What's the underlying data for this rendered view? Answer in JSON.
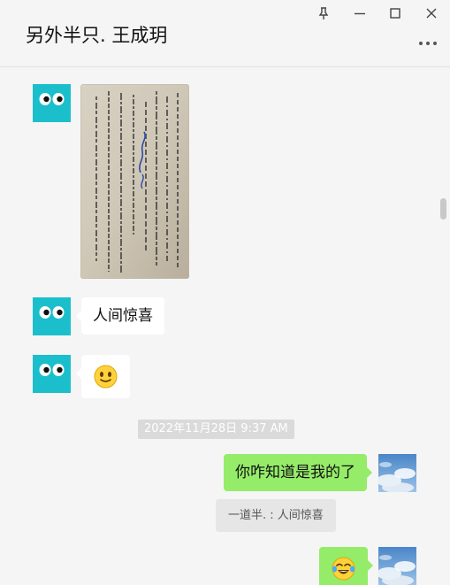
{
  "header": {
    "title": "另外半只. 王成玥",
    "window_controls": [
      "pin-icon",
      "minimize-icon",
      "maximize-icon",
      "close-icon"
    ],
    "more_icon": "more-icon"
  },
  "messages": [
    {
      "side": "left",
      "type": "image",
      "sender_avatar": "eyes-avatar"
    },
    {
      "side": "left",
      "type": "text",
      "text": "人间惊喜",
      "sender_avatar": "eyes-avatar"
    },
    {
      "side": "left",
      "type": "emoji",
      "emoji": "🙂",
      "emoji_name": "smile-emoji",
      "sender_avatar": "eyes-avatar"
    },
    {
      "type": "timestamp",
      "text": "2022年11月28日 9:37 AM"
    },
    {
      "side": "right",
      "type": "text",
      "text": "你咋知道是我的了",
      "sender_avatar": "sky-avatar"
    },
    {
      "type": "quote",
      "text": "一道半. : 人间惊喜"
    },
    {
      "side": "right",
      "type": "emoji",
      "emoji": "😂",
      "emoji_name": "laugh-cry-emoji",
      "sender_avatar": "sky-avatar"
    }
  ],
  "colors": {
    "background": "#f5f5f5",
    "sent_bubble": "#95ec69",
    "received_bubble": "#ffffff",
    "avatar_teal": "#1bbfcc",
    "timestamp_bg": "#dadada"
  }
}
